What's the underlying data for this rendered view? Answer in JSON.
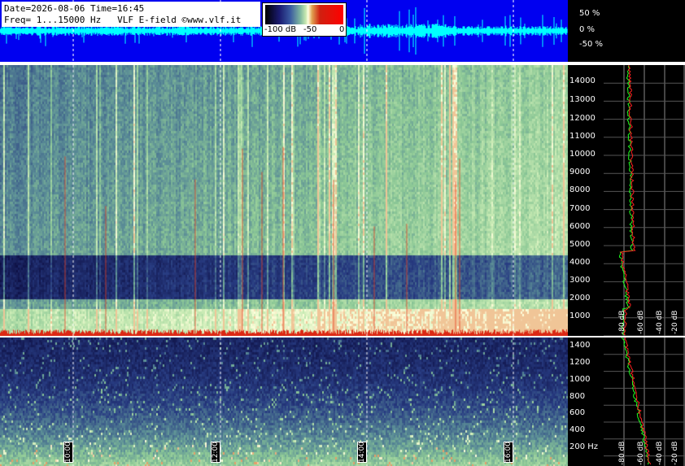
{
  "header": {
    "line1": "Date=2026-08-06 Time=16:45",
    "line2": "Freq= 1...15000 Hz   VLF E-field ©www.vlf.it"
  },
  "colorbar": {
    "labels": [
      "-100 dB",
      "-50",
      "0"
    ]
  },
  "waveform": {
    "scale_labels": [
      "50 %",
      "0 %",
      "-50 %"
    ]
  },
  "main_spectrogram": {
    "freq_ticks": [
      "14000",
      "13000",
      "12000",
      "11000",
      "10000",
      "9000",
      "8000",
      "7000",
      "6000",
      "5000",
      "4000",
      "3000",
      "2000",
      "1000"
    ]
  },
  "low_spectrogram": {
    "freq_ticks": [
      "1400",
      "1200",
      "1000",
      "800",
      "600",
      "400",
      "200 Hz"
    ]
  },
  "time_markers": [
    "10:00",
    "12:00",
    "14:00",
    "16:00"
  ],
  "spectrum_db_labels": [
    "-80 dB",
    "-60 dB",
    "-40 dB",
    "-20 dB"
  ],
  "colors": {
    "waveform_bg": "#0000f0",
    "waveform_trace": "#00ffff",
    "spectrum_line_red": "#ff2020",
    "spectrum_line_green": "#20ff20"
  }
}
